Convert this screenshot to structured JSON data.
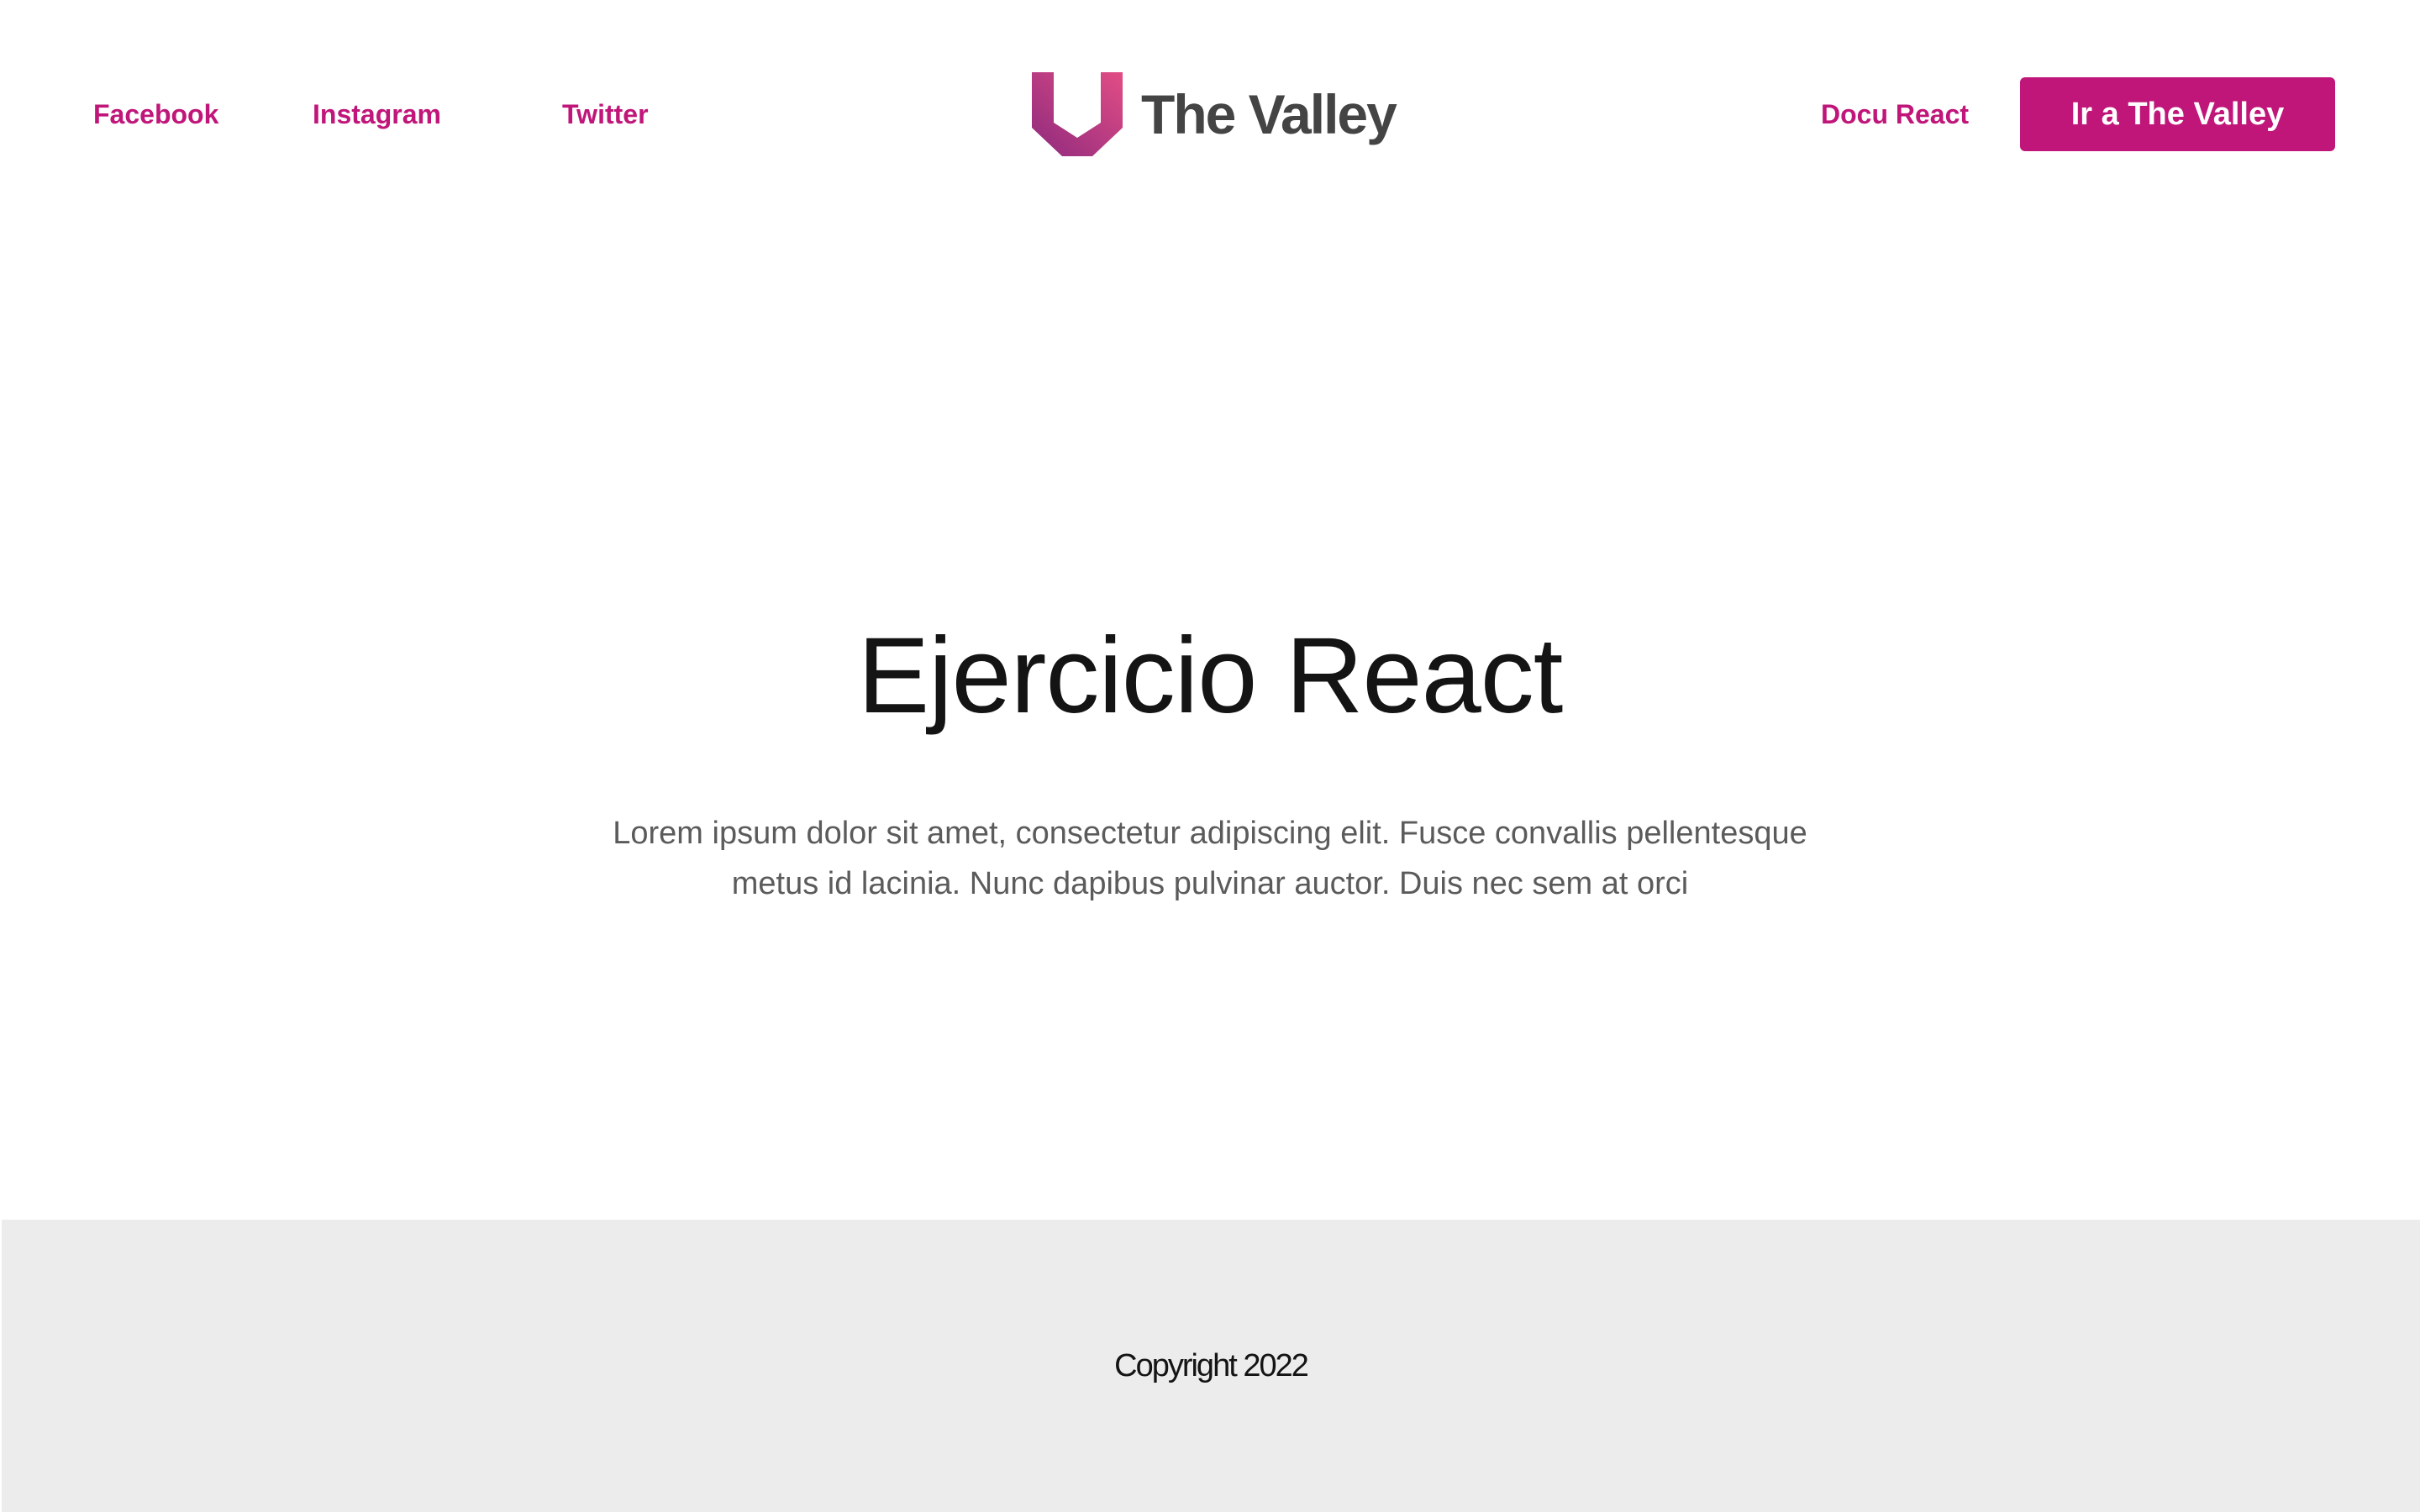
{
  "header": {
    "nav_left": [
      {
        "label": "Facebook"
      },
      {
        "label": "Instagram"
      },
      {
        "label": "Twitter"
      }
    ],
    "logo": {
      "icon": "valley-logo-icon",
      "text": "The Valley"
    },
    "nav_right": {
      "docu_label": "Docu React",
      "cta_label": "Ir a The Valley"
    }
  },
  "hero": {
    "title": "Ejercicio React",
    "body": "Lorem ipsum dolor sit amet, consectetur adipiscing elit. Fusce convallis pellentesque metus id lacinia. Nunc dapibus pulvinar auctor. Duis nec sem at orci"
  },
  "footer": {
    "copyright": "Copyright 2022"
  },
  "colors": {
    "accent": "#c0167a",
    "logo_gradient_start": "#8e2a7e",
    "logo_gradient_end": "#e24d85",
    "footer_bg": "#ececec",
    "heading": "#141414",
    "body_text": "#5b5b5b"
  }
}
